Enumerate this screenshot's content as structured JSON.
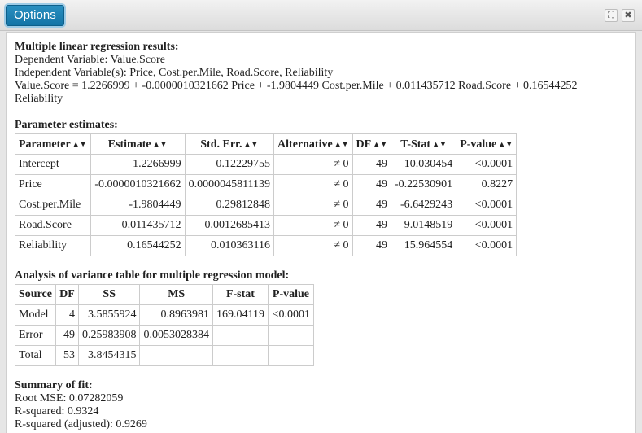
{
  "toolbar": {
    "options_label": "Options"
  },
  "window_controls": {
    "expand_glyph": "⛶",
    "close_glyph": "✖"
  },
  "regression": {
    "heading": "Multiple linear regression results:",
    "dependent": "Dependent Variable: Value.Score",
    "independent": "Independent Variable(s): Price, Cost.per.Mile, Road.Score, Reliability",
    "equation_line1": "Value.Score = 1.2266999 + -0.0000010321662 Price + -1.9804449 Cost.per.Mile + 0.011435712 Road.Score + 0.16544252",
    "equation_line2": "Reliability"
  },
  "param_estimates": {
    "heading": "Parameter estimates:",
    "sort_glyph": "▲▼",
    "columns": [
      "Parameter",
      "Estimate",
      "Std. Err.",
      "Alternative",
      "DF",
      "T-Stat",
      "P-value"
    ],
    "rows": [
      [
        "Intercept",
        "1.2266999",
        "0.12229755",
        "≠ 0",
        "49",
        "10.030454",
        "<0.0001"
      ],
      [
        "Price",
        "-0.0000010321662",
        "0.0000045811139",
        "≠ 0",
        "49",
        "-0.22530901",
        "0.8227"
      ],
      [
        "Cost.per.Mile",
        "-1.9804449",
        "0.29812848",
        "≠ 0",
        "49",
        "-6.6429243",
        "<0.0001"
      ],
      [
        "Road.Score",
        "0.011435712",
        "0.0012685413",
        "≠ 0",
        "49",
        "9.0148519",
        "<0.0001"
      ],
      [
        "Reliability",
        "0.16544252",
        "0.010363116",
        "≠ 0",
        "49",
        "15.964554",
        "<0.0001"
      ]
    ]
  },
  "anova": {
    "heading": "Analysis of variance table for multiple regression model:",
    "columns": [
      "Source",
      "DF",
      "SS",
      "MS",
      "F-stat",
      "P-value"
    ],
    "rows": [
      [
        "Model",
        "4",
        "3.5855924",
        "0.8963981",
        "169.04119",
        "<0.0001"
      ],
      [
        "Error",
        "49",
        "0.25983908",
        "0.0053028384",
        "",
        ""
      ],
      [
        "Total",
        "53",
        "3.8454315",
        "",
        "",
        ""
      ]
    ]
  },
  "fit": {
    "heading": "Summary of fit:",
    "root_mse": "Root MSE: 0.07282059",
    "r_squared": "R-squared: 0.9324",
    "r_squared_adj": "R-squared (adjusted): 0.9269"
  }
}
